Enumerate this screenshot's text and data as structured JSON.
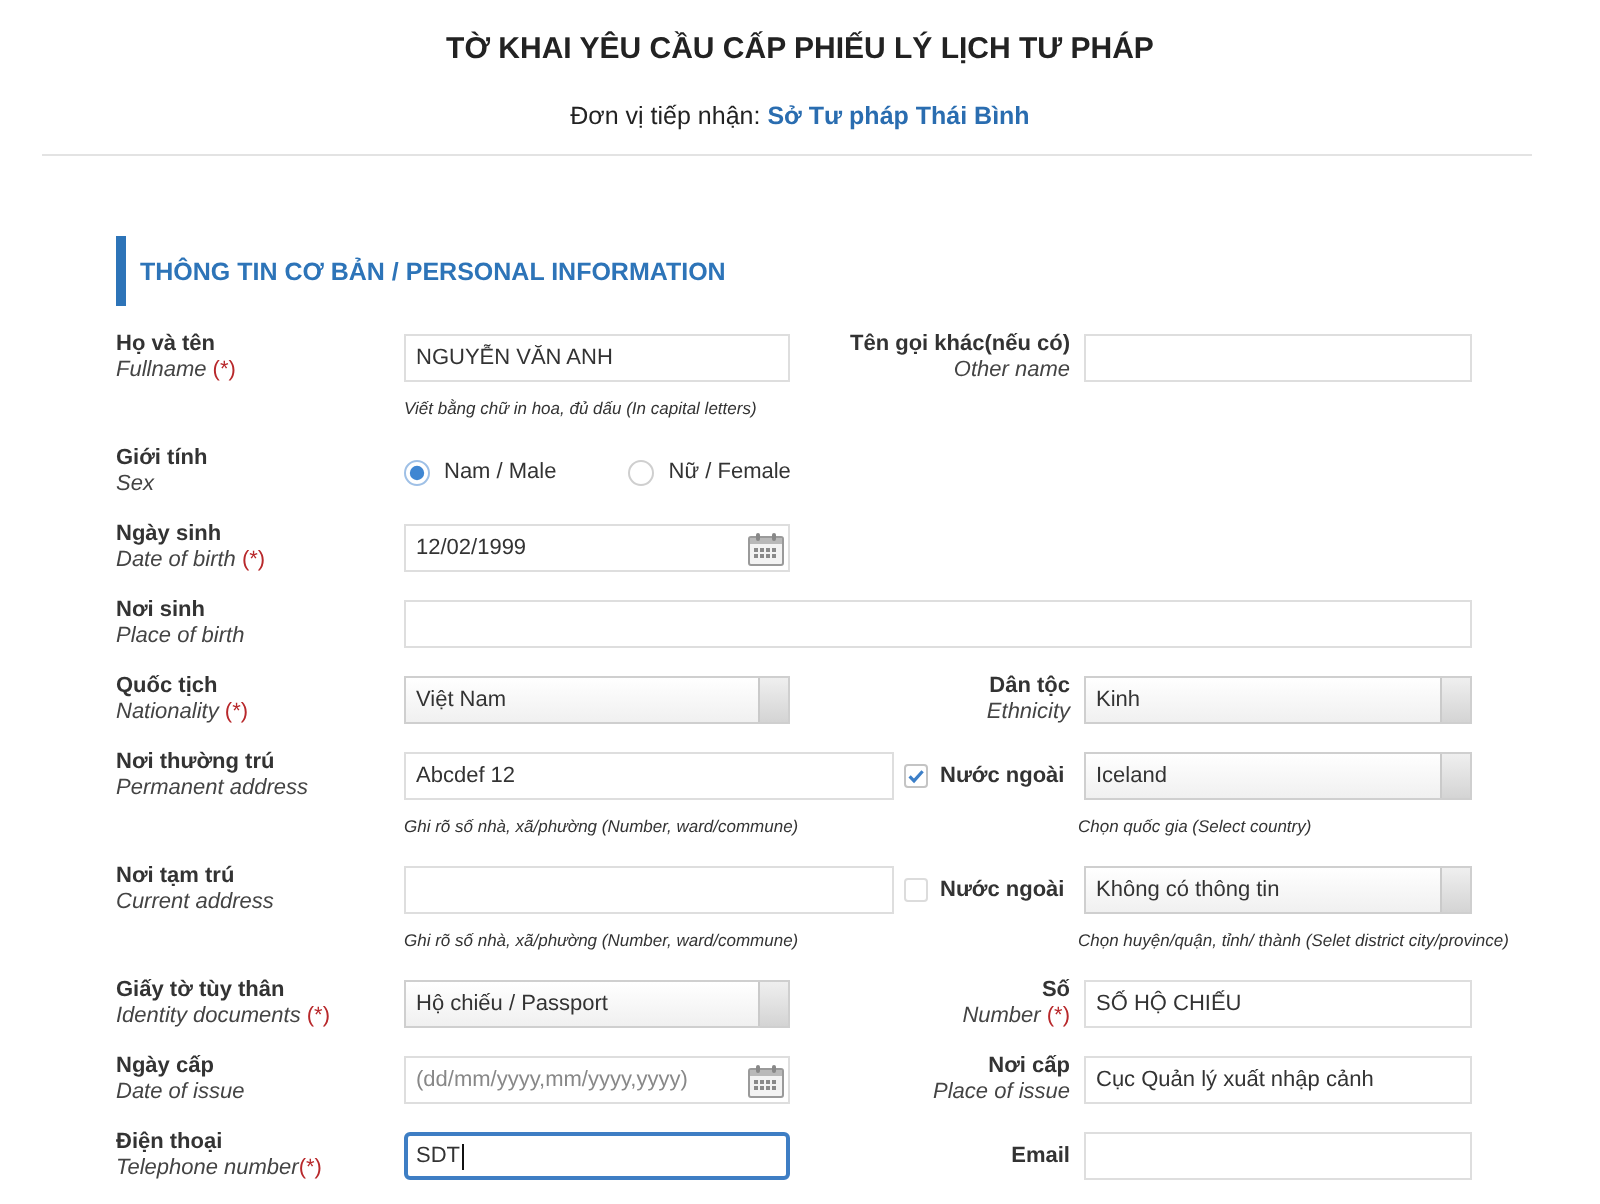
{
  "header": {
    "title": "TỜ KHAI YÊU CẦU CẤP PHIẾU LÝ LỊCH TƯ PHÁP",
    "agency_label": "Đơn vị tiếp nhận:",
    "agency": "Sở Tư pháp Thái Bình"
  },
  "section": {
    "title": "THÔNG TIN CƠ BẢN / PERSONAL INFORMATION"
  },
  "rows": [
    {
      "kind": "text",
      "label": {
        "vi": "Họ và tên",
        "en": "Fullname ",
        "mark": "(*)"
      },
      "value": "NGUYỄN VĂN ANH",
      "hint": "Viết bằng chữ in hoa, đủ dấu (In capital letters)",
      "right": {
        "kind": "text",
        "label": {
          "vi": "Tên gọi khác(nếu có)",
          "en": "Other name"
        }
      }
    },
    {
      "kind": "radio",
      "label": {
        "vi": "Giới tính",
        "en": "Sex"
      },
      "options": [
        {
          "label": "Nam / Male",
          "selected": true
        },
        {
          "label": "Nữ / Female",
          "selected": false
        }
      ]
    },
    {
      "kind": "date",
      "label": {
        "vi": "Ngày sinh",
        "en": "Date of birth ",
        "mark": "(*)"
      },
      "value": "12/02/1999"
    },
    {
      "kind": "text",
      "label": {
        "vi": "Nơi sinh",
        "en": "Place of birth"
      }
    },
    {
      "kind": "select",
      "label": {
        "vi": "Quốc tịch",
        "en": "Nationality ",
        "mark": "(*)"
      },
      "value": "Việt Nam",
      "right": {
        "kind": "select",
        "label": {
          "vi": "Dân tộc",
          "en": "Ethnicity"
        },
        "value": "Kinh"
      }
    },
    {
      "kind": "address",
      "label": {
        "vi": "Nơi thường trú",
        "en": "Permanent address"
      },
      "value": "Abcdef 12",
      "hint": "Ghi rõ số nhà, xã/phường (Number, ward/commune)",
      "foreign": {
        "label": "Nước ngoài",
        "checked": true
      },
      "right": {
        "kind": "select",
        "value": "Iceland",
        "hint": "Chọn quốc gia (Select country)"
      }
    },
    {
      "kind": "address",
      "label": {
        "vi": "Nơi tạm trú",
        "en": "Current address"
      },
      "hint": "Ghi rõ số nhà, xã/phường (Number, ward/commune)",
      "foreign": {
        "label": "Nước ngoài",
        "checked": false
      },
      "right": {
        "kind": "select",
        "value": "Không có thông tin",
        "hint": "Chọn huyện/quận, tỉnh/ thành (Selet district city/province)"
      }
    },
    {
      "kind": "select",
      "label": {
        "vi": "Giấy tờ tùy thân",
        "en": "Identity documents ",
        "mark": "(*)"
      },
      "value": "Hộ chiếu / Passport",
      "right": {
        "kind": "text",
        "label": {
          "vi": "Số",
          "en": "Number ",
          "mark": "(*)"
        },
        "value": "SỐ HỘ CHIẾU"
      }
    },
    {
      "kind": "date",
      "label": {
        "vi": "Ngày cấp",
        "en": "Date of issue"
      },
      "placeholder": "(dd/mm/yyyy,mm/yyyy,yyyy)",
      "right": {
        "kind": "text",
        "label": {
          "vi": "Nơi cấp",
          "en": "Place of issue"
        },
        "value": "Cục Quản lý xuất nhập cảnh"
      }
    },
    {
      "kind": "text",
      "label": {
        "vi": "Điện thoại",
        "en": "Telephone number",
        "mark": "(*)"
      },
      "value": "SDT",
      "focused": true,
      "right": {
        "kind": "text",
        "label": {
          "vi": "Email"
        }
      }
    }
  ]
}
